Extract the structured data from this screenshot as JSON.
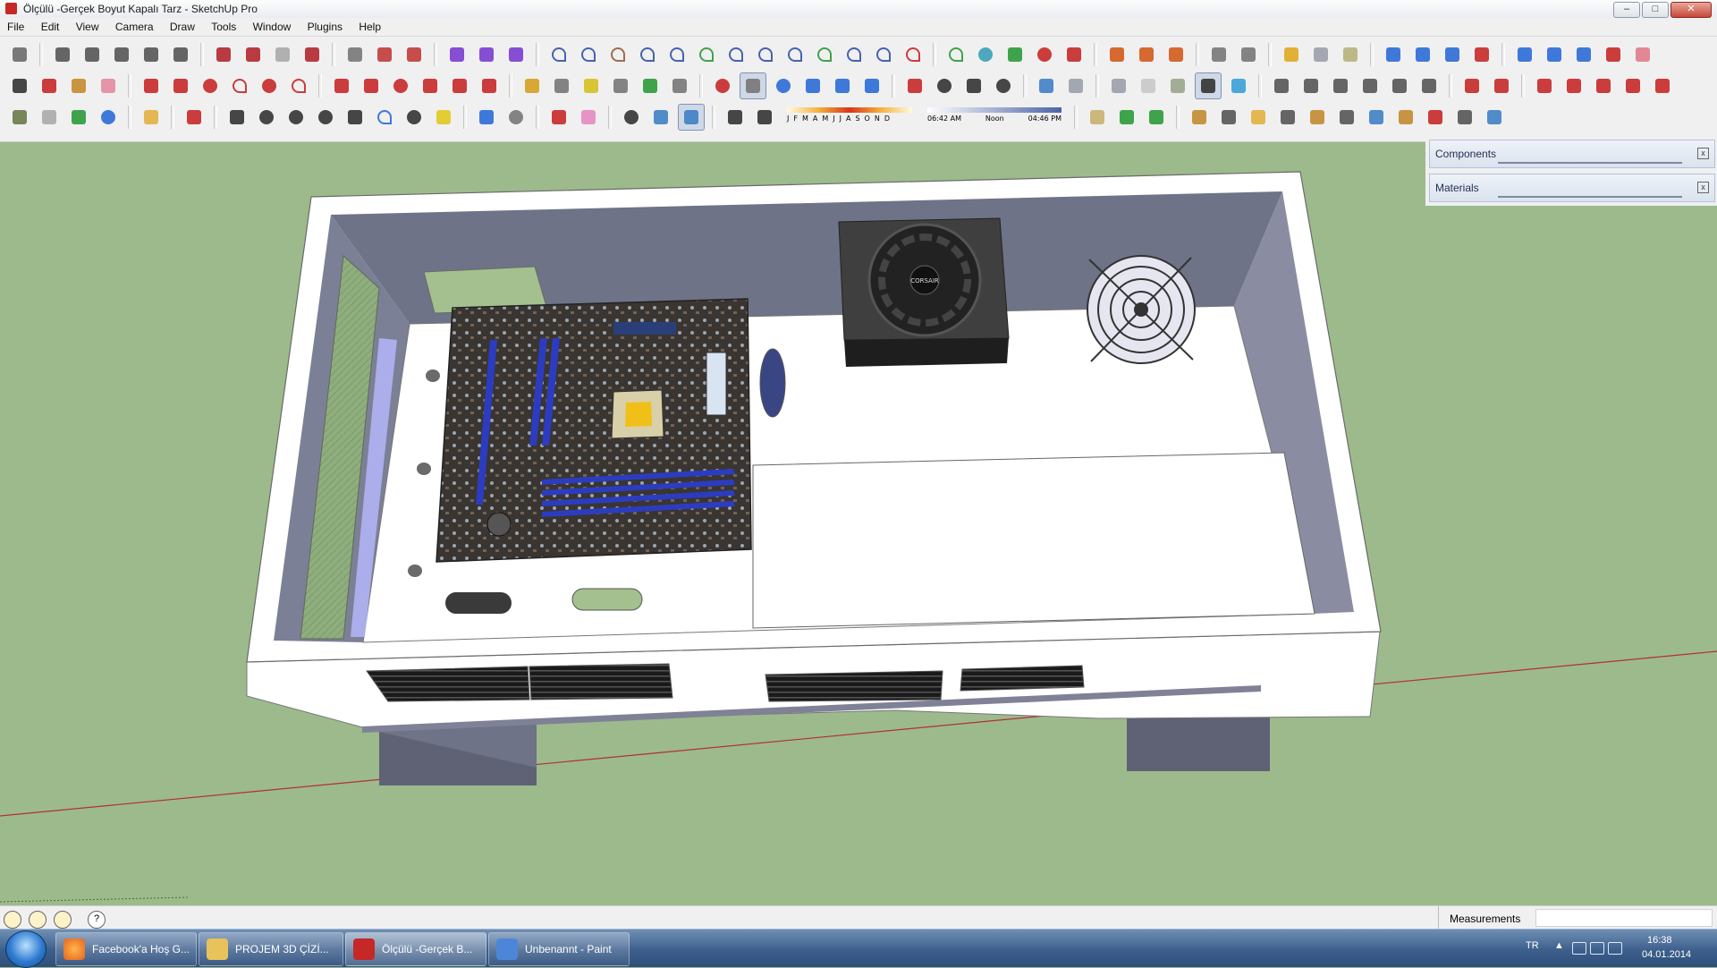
{
  "window": {
    "title": "Ölçülü -Gerçek Boyut Kapalı Tarz - SketchUp Pro",
    "controls": {
      "minimize": "–",
      "maximize": "□",
      "close": "✕"
    }
  },
  "menu": [
    "File",
    "Edit",
    "View",
    "Camera",
    "Draw",
    "Tools",
    "Window",
    "Plugins",
    "Help"
  ],
  "shadow_settings": {
    "months": [
      "J",
      "F",
      "M",
      "A",
      "M",
      "J",
      "J",
      "A",
      "S",
      "O",
      "N",
      "D"
    ],
    "time_start": "06:42 AM",
    "time_mid": "Noon",
    "time_end": "04:46 PM"
  },
  "tray": {
    "components": "Components",
    "materials": "Materials",
    "close": "x"
  },
  "scene": {
    "psu_brand": "CORSAIR"
  },
  "statusbar": {
    "measurements_label": "Measurements",
    "measurements_value": "",
    "help_icon": "?"
  },
  "taskbar": {
    "tasks": [
      {
        "label": "Facebook'a Hoş G...",
        "icon_color": "#e5631f"
      },
      {
        "label": "PROJEM 3D ÇİZİ...",
        "icon_color": "#e8c25a"
      },
      {
        "label": "Ölçülü -Gerçek B...",
        "icon_color": "#c62828"
      },
      {
        "label": "Unbenannt - Paint",
        "icon_color": "#4d86d8"
      }
    ],
    "language": "TR",
    "time": "16:38",
    "date": "04.01.2014"
  },
  "colors": {
    "ground": "#9dba8c",
    "case_white": "#ffffff",
    "case_wall": "#6f7388",
    "case_side": "#8d90a5"
  }
}
